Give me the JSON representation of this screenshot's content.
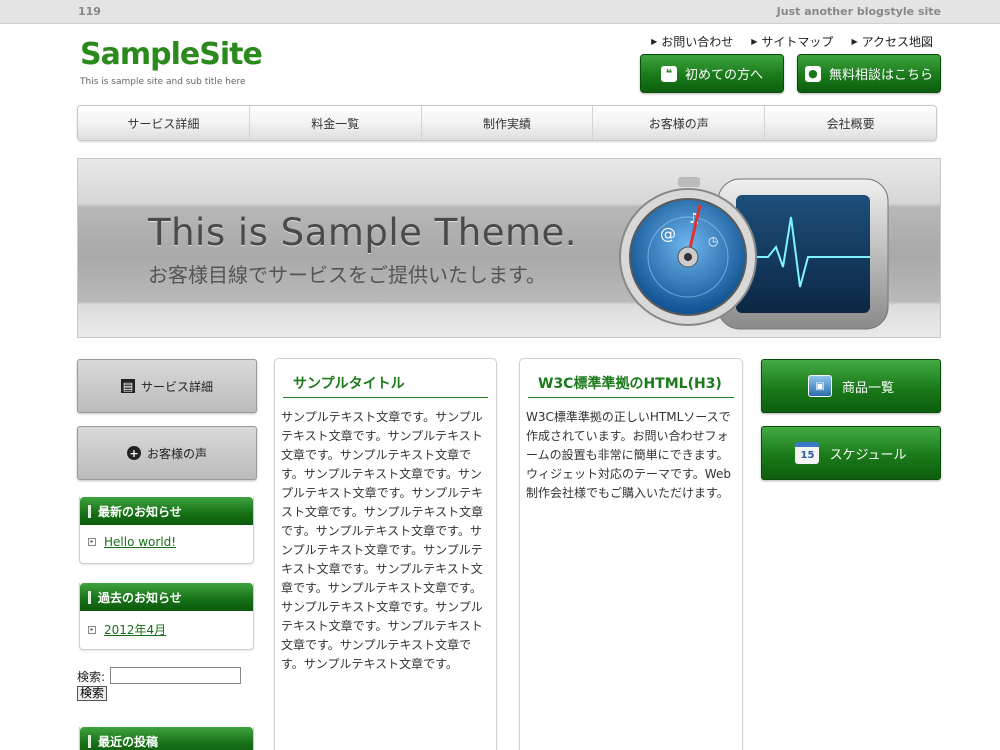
{
  "topbar": {
    "number": "119",
    "tagline": "Just another blogstyle site"
  },
  "header": {
    "logo": "SampleSite",
    "subtitle": "This is sample site and sub title here",
    "utility_links": [
      "お問い合わせ",
      "サイトマップ",
      "アクセス地図"
    ],
    "buttons": {
      "first_time": "初めての方へ",
      "consult": "無料相談はこちら"
    }
  },
  "nav": {
    "items": [
      "サービス詳細",
      "料金一覧",
      "制作実績",
      "お客様の声",
      "会社概要"
    ]
  },
  "hero": {
    "title": "This is Sample Theme.",
    "subtitle": "お客様目線でサービスをご提供いたします。"
  },
  "left_sidebar": {
    "buttons": [
      "サービス詳細",
      "お客様の声"
    ],
    "widgets": [
      {
        "title": "最新のお知らせ",
        "link": "Hello world!"
      },
      {
        "title": "過去のお知らせ",
        "link": "2012年4月"
      },
      {
        "title": "最近の投稿"
      }
    ],
    "search": {
      "label": "検索:",
      "button": "検索"
    }
  },
  "content": {
    "col1": {
      "title": "サンプルタイトル",
      "body": "サンプルテキスト文章です。サンプルテキスト文章です。サンプルテキスト文章です。サンプルテキスト文章です。サンプルテキスト文章です。サンプルテキスト文章です。サンプルテキスト文章です。サンプルテキスト文章です。サンプルテキスト文章です。サンプルテキスト文章です。サンプルテキスト文章です。サンプルテキスト文章です。サンプルテキスト文章です。サンプルテキスト文章です。サンプルテキスト文章です。サンプルテキスト文章です。サンプルテキスト文章です。サンプルテキスト文章です。"
    },
    "col2": {
      "title": "W3C標準準拠のHTML(H3)",
      "body": "W3C標準準拠の正しいHTMLソースで作成されています。お問い合わせフォームの設置も非常に簡単にできます。ウィジェット対応のテーマです。Web制作会社様でもご購入いただけます。"
    }
  },
  "right_sidebar": {
    "buttons": [
      "商品一覧",
      "スケジュール"
    ],
    "calendar_icon_text": "15"
  },
  "colors": {
    "brand_green": "#1a7a1a",
    "logo_green": "#2a8a1c",
    "link_green": "#1a6f1a"
  }
}
